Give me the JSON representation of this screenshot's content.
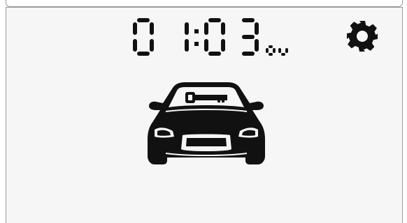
{
  "header": {
    "time_hours": "01",
    "time_minutes": "03",
    "time_suffix": "OU",
    "time_display": "01:03OU"
  },
  "icons": {
    "settings": "gear-icon",
    "vehicle": "car-icon",
    "key": "key-icon"
  },
  "colors": {
    "screen_background": "#f6f6f6",
    "segment_color": "#111111",
    "border": "#9a9a9a"
  }
}
